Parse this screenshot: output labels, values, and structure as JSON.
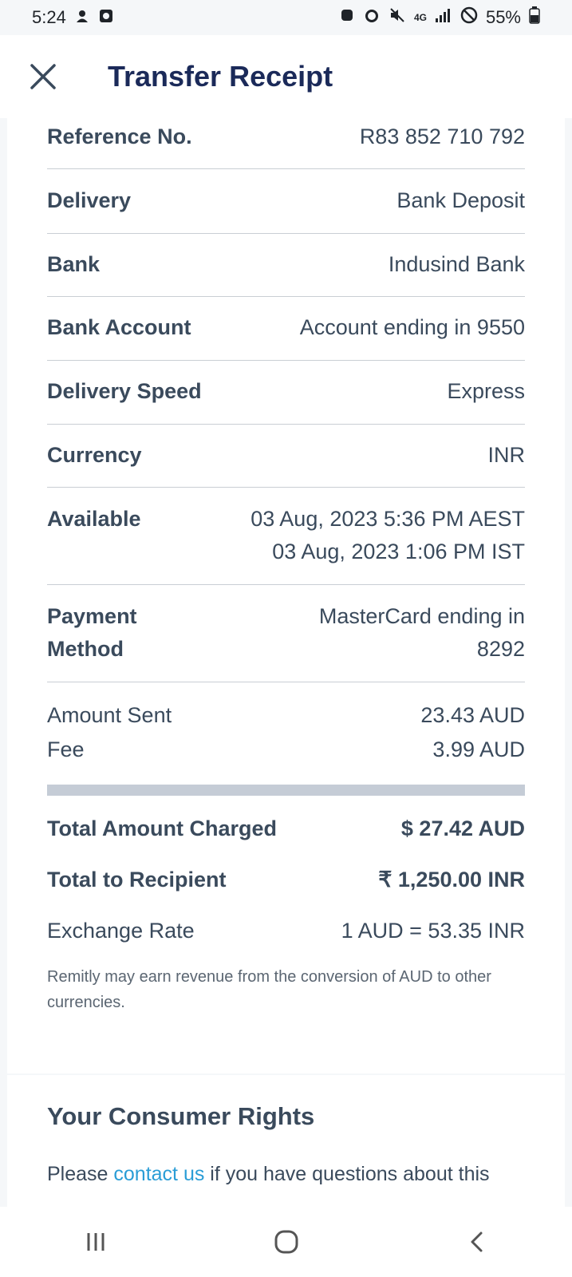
{
  "status": {
    "time": "5:24",
    "network": "4G",
    "battery": "55%"
  },
  "header": {
    "title": "Transfer Receipt"
  },
  "details": [
    {
      "label": "Reference No.",
      "value": "R83 852 710 792"
    },
    {
      "label": "Delivery",
      "value": "Bank Deposit"
    },
    {
      "label": "Bank",
      "value": "Indusind Bank"
    },
    {
      "label": "Bank Account",
      "value": "Account ending in 9550"
    },
    {
      "label": "Delivery Speed",
      "value": "Express"
    },
    {
      "label": "Currency",
      "value": "INR"
    },
    {
      "label": "Available",
      "value_line1": "03 Aug, 2023 5:36 PM AEST",
      "value_line2": "03 Aug, 2023 1:06 PM IST"
    },
    {
      "label_line1": "Payment",
      "label_line2": "Method",
      "value_line1": "MasterCard ending in",
      "value_line2": "8292"
    }
  ],
  "amounts": {
    "sent_label": "Amount Sent",
    "sent_value": "23.43 AUD",
    "fee_label": "Fee",
    "fee_value": "3.99 AUD"
  },
  "totals": {
    "charged_label": "Total Amount Charged",
    "charged_value": "$ 27.42 AUD",
    "recipient_label": "Total to Recipient",
    "recipient_value": "₹ 1,250.00 INR",
    "rate_label": "Exchange Rate",
    "rate_value": "1 AUD = 53.35 INR"
  },
  "note": "Remitly may earn revenue from the conversion of AUD to other currencies.",
  "rights": {
    "title": "Your Consumer Rights",
    "text_before": "Please ",
    "link": "contact us",
    "text_after": " if you have questions about this"
  }
}
